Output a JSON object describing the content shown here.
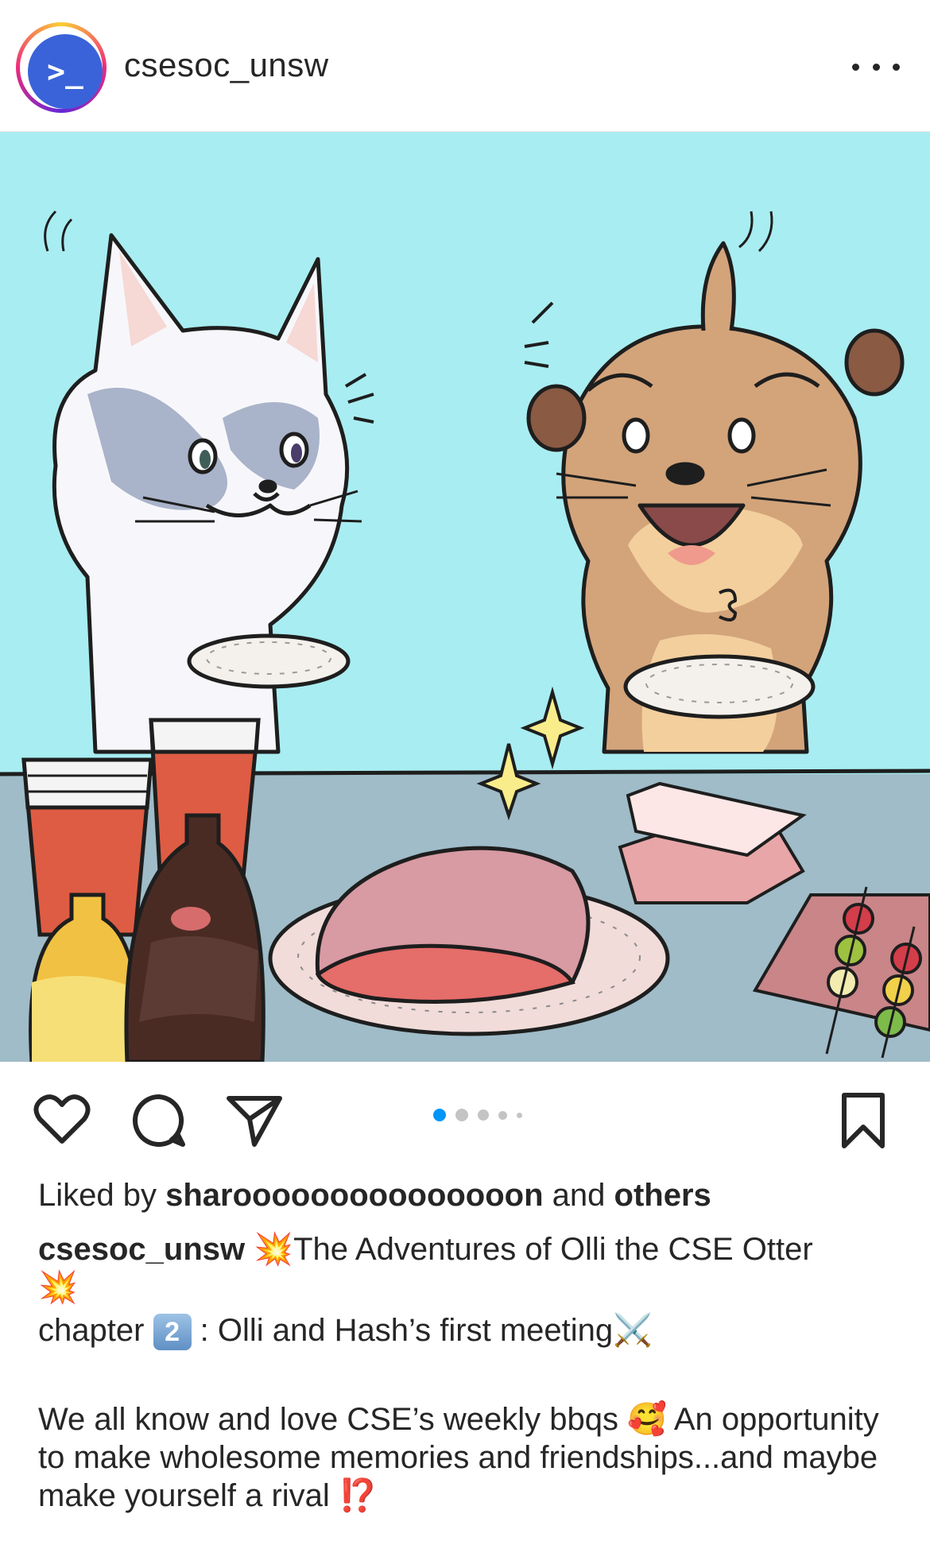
{
  "header": {
    "avatar_glyph": ">_",
    "username": "csesoc_unsw",
    "more_icon": "more-horizontal-icon"
  },
  "post": {
    "image_description_icon": "comic-illustration",
    "carousel": {
      "total": 5,
      "active_index": 0
    }
  },
  "actions": {
    "like_icon": "heart-icon",
    "comment_icon": "comment-icon",
    "share_icon": "send-icon",
    "save_icon": "bookmark-icon"
  },
  "likes": {
    "prefix": "Liked by ",
    "user": "sharooooooooooooooon",
    "middle": " and ",
    "others": "others"
  },
  "caption": {
    "username": "csesoc_unsw",
    "title_emoji": "💥",
    "title": "The Adventures of Olli the CSE Otter",
    "chapter_label": "chapter",
    "chapter_number": "2",
    "chapter_title": ": Olli and Hash’s first meeting",
    "chapter_emoji": "⚔️",
    "body": "We all know and love CSE’s weekly bbqs",
    "body_emoji": "🥰",
    "body_rest": "An opportunity to make wholesome memories and friendships...and maybe make yourself a rival",
    "end_emoji": "⁉️"
  },
  "colors": {
    "accent_blue": "#0095f6",
    "avatar_blue": "#3a63d9",
    "sky": "#a8edf1",
    "table": "#9fbcc8"
  }
}
